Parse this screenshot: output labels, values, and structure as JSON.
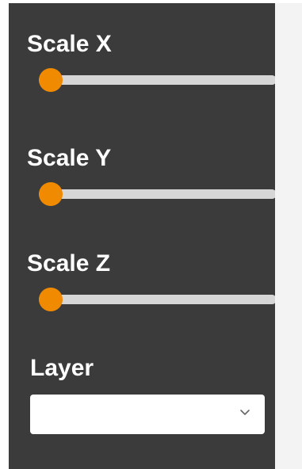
{
  "theme": {
    "panel_bg": "#3b3b3b",
    "label_color": "#ffffff",
    "accent": "#f08a00",
    "track": "#d6d6d6",
    "right_area_bg": "#f3f3f3"
  },
  "controls": {
    "scale_x": {
      "label": "Scale X",
      "value_fraction": 0.0
    },
    "scale_y": {
      "label": "Scale Y",
      "value_fraction": 0.0
    },
    "scale_z": {
      "label": "Scale Z",
      "value_fraction": 0.0
    },
    "layer": {
      "label": "Layer",
      "selected": "",
      "icon": "chevron-down-icon"
    }
  }
}
